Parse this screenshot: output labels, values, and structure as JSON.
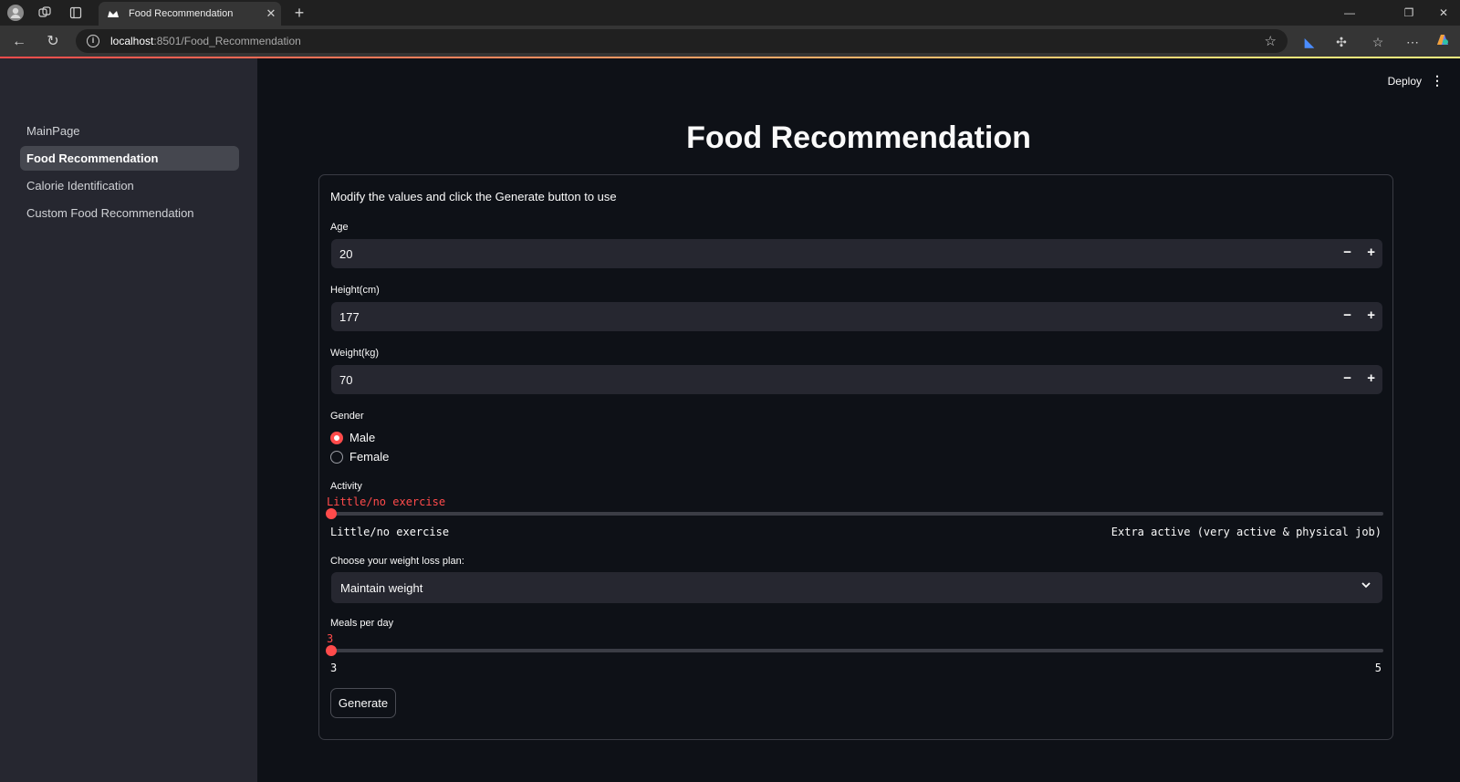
{
  "browser": {
    "tab_title": "Food Recommendation",
    "url_host": "localhost",
    "url_path": ":8501/Food_Recommendation"
  },
  "sidebar": {
    "items": [
      {
        "label": "MainPage",
        "active": false
      },
      {
        "label": "Food Recommendation",
        "active": true
      },
      {
        "label": "Calorie Identification",
        "active": false
      },
      {
        "label": "Custom Food Recommendation",
        "active": false
      }
    ]
  },
  "header": {
    "deploy_label": "Deploy"
  },
  "main": {
    "title": "Food Recommendation",
    "intro": "Modify the values and click the Generate button to use",
    "age": {
      "label": "Age",
      "value": "20",
      "minus": "−",
      "plus": "+"
    },
    "height": {
      "label": "Height(cm)",
      "value": "177",
      "minus": "−",
      "plus": "+"
    },
    "weight": {
      "label": "Weight(kg)",
      "value": "70",
      "minus": "−",
      "plus": "+"
    },
    "gender": {
      "label": "Gender",
      "options": [
        {
          "label": "Male",
          "selected": true
        },
        {
          "label": "Female",
          "selected": false
        }
      ]
    },
    "activity": {
      "label": "Activity",
      "current": "Little/no exercise",
      "min_label": "Little/no exercise",
      "max_label": "Extra active (very active & physical job)",
      "position_fraction": 0
    },
    "plan": {
      "label": "Choose your weight loss plan:",
      "value": "Maintain weight"
    },
    "meals": {
      "label": "Meals per day",
      "current": "3",
      "min_label": "3",
      "max_label": "5",
      "position_fraction": 0
    },
    "generate_label": "Generate"
  },
  "colors": {
    "accent": "#ff4b4b",
    "background": "#0e1117",
    "sidebar_bg": "#262730",
    "input_bg": "#262730"
  }
}
